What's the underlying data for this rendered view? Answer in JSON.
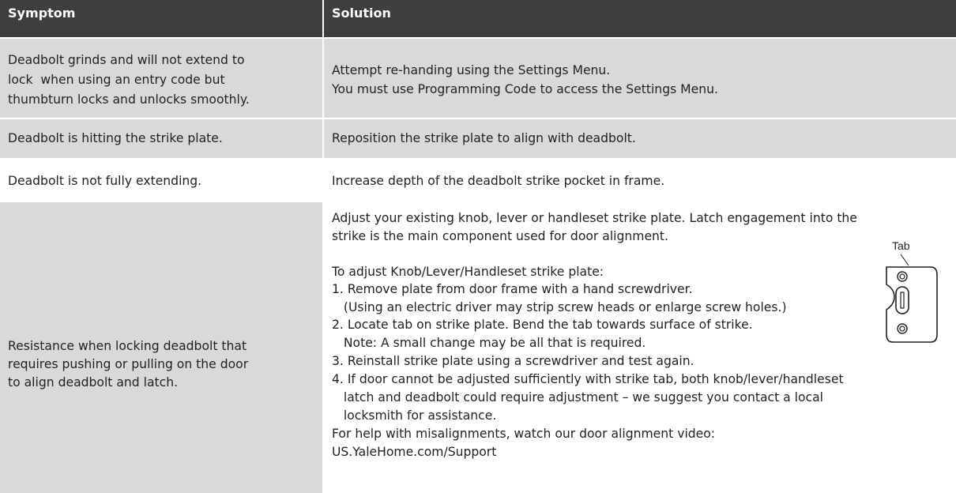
{
  "header": {
    "symptom": "Symptom",
    "solution": "Solution"
  },
  "rows": [
    {
      "symptom": [
        "Deadbolt grinds and will not extend to",
        "lock  when using an entry code but",
        "thumbturn locks and unlocks smoothly."
      ],
      "solution": [
        "Attempt re-handing using the Settings Menu.",
        "You must use Programming Code to access the Settings Menu."
      ]
    },
    {
      "symptom": [
        "Deadbolt is hitting the strike plate."
      ],
      "solution": [
        "Reposition the strike plate to align with deadbolt."
      ]
    },
    {
      "symptom": [
        "Deadbolt is not fully extending."
      ],
      "solution": [
        "Increase depth of the deadbolt strike pocket in frame."
      ]
    },
    {
      "symptom": [
        "Resistance when locking deadbolt that",
        "requires pushing or pulling on the door",
        "to align deadbolt and latch."
      ],
      "solution": [
        "Adjust your existing knob, lever or handleset strike plate. Latch engagement into the",
        "strike is the main component used for door alignment.",
        "",
        "To adjust Knob/Lever/Handleset strike plate:",
        "1. Remove plate from door frame with a hand screwdriver.",
        "   (Using an electric driver may strip screw heads or enlarge screw holes.)",
        "2. Locate tab on strike plate. Bend the tab towards surface of strike.",
        "   Note: A small change may be all that is required.",
        "3. Reinstall strike plate using a screwdriver and test again.",
        "4. If door cannot be adjusted sufficiently with strike tab, both knob/lever/handleset",
        "   latch and deadbolt could require adjustment – we suggest you contact a local",
        "   locksmith for assistance.",
        "For help with misalignments, watch our door alignment video:",
        "US.YaleHome.com/Support"
      ]
    }
  ],
  "figure": {
    "label": "Tab",
    "icon": "strike-plate-icon"
  },
  "colors": {
    "header_bg": "#3d3e40",
    "shade_bg": "#d9d9d9",
    "text": "#231f20"
  }
}
